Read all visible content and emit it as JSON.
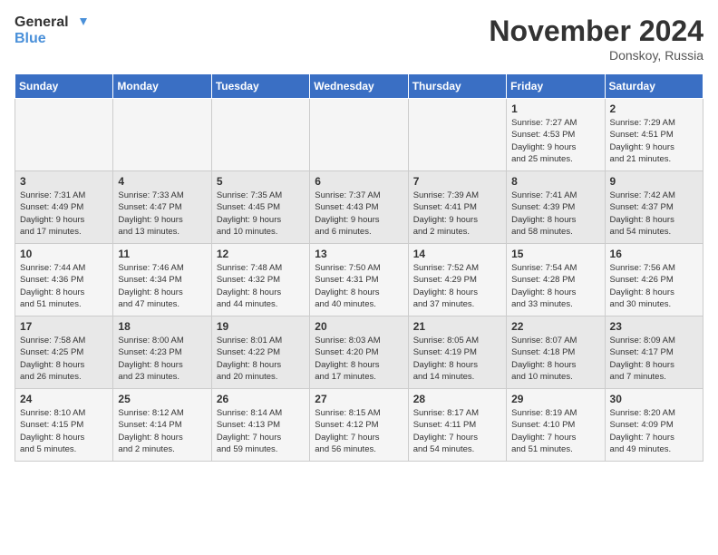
{
  "header": {
    "logo_general": "General",
    "logo_blue": "Blue",
    "month_title": "November 2024",
    "location": "Donskoy, Russia"
  },
  "days_of_week": [
    "Sunday",
    "Monday",
    "Tuesday",
    "Wednesday",
    "Thursday",
    "Friday",
    "Saturday"
  ],
  "weeks": [
    [
      {
        "day": "",
        "info": ""
      },
      {
        "day": "",
        "info": ""
      },
      {
        "day": "",
        "info": ""
      },
      {
        "day": "",
        "info": ""
      },
      {
        "day": "",
        "info": ""
      },
      {
        "day": "1",
        "info": "Sunrise: 7:27 AM\nSunset: 4:53 PM\nDaylight: 9 hours\nand 25 minutes."
      },
      {
        "day": "2",
        "info": "Sunrise: 7:29 AM\nSunset: 4:51 PM\nDaylight: 9 hours\nand 21 minutes."
      }
    ],
    [
      {
        "day": "3",
        "info": "Sunrise: 7:31 AM\nSunset: 4:49 PM\nDaylight: 9 hours\nand 17 minutes."
      },
      {
        "day": "4",
        "info": "Sunrise: 7:33 AM\nSunset: 4:47 PM\nDaylight: 9 hours\nand 13 minutes."
      },
      {
        "day": "5",
        "info": "Sunrise: 7:35 AM\nSunset: 4:45 PM\nDaylight: 9 hours\nand 10 minutes."
      },
      {
        "day": "6",
        "info": "Sunrise: 7:37 AM\nSunset: 4:43 PM\nDaylight: 9 hours\nand 6 minutes."
      },
      {
        "day": "7",
        "info": "Sunrise: 7:39 AM\nSunset: 4:41 PM\nDaylight: 9 hours\nand 2 minutes."
      },
      {
        "day": "8",
        "info": "Sunrise: 7:41 AM\nSunset: 4:39 PM\nDaylight: 8 hours\nand 58 minutes."
      },
      {
        "day": "9",
        "info": "Sunrise: 7:42 AM\nSunset: 4:37 PM\nDaylight: 8 hours\nand 54 minutes."
      }
    ],
    [
      {
        "day": "10",
        "info": "Sunrise: 7:44 AM\nSunset: 4:36 PM\nDaylight: 8 hours\nand 51 minutes."
      },
      {
        "day": "11",
        "info": "Sunrise: 7:46 AM\nSunset: 4:34 PM\nDaylight: 8 hours\nand 47 minutes."
      },
      {
        "day": "12",
        "info": "Sunrise: 7:48 AM\nSunset: 4:32 PM\nDaylight: 8 hours\nand 44 minutes."
      },
      {
        "day": "13",
        "info": "Sunrise: 7:50 AM\nSunset: 4:31 PM\nDaylight: 8 hours\nand 40 minutes."
      },
      {
        "day": "14",
        "info": "Sunrise: 7:52 AM\nSunset: 4:29 PM\nDaylight: 8 hours\nand 37 minutes."
      },
      {
        "day": "15",
        "info": "Sunrise: 7:54 AM\nSunset: 4:28 PM\nDaylight: 8 hours\nand 33 minutes."
      },
      {
        "day": "16",
        "info": "Sunrise: 7:56 AM\nSunset: 4:26 PM\nDaylight: 8 hours\nand 30 minutes."
      }
    ],
    [
      {
        "day": "17",
        "info": "Sunrise: 7:58 AM\nSunset: 4:25 PM\nDaylight: 8 hours\nand 26 minutes."
      },
      {
        "day": "18",
        "info": "Sunrise: 8:00 AM\nSunset: 4:23 PM\nDaylight: 8 hours\nand 23 minutes."
      },
      {
        "day": "19",
        "info": "Sunrise: 8:01 AM\nSunset: 4:22 PM\nDaylight: 8 hours\nand 20 minutes."
      },
      {
        "day": "20",
        "info": "Sunrise: 8:03 AM\nSunset: 4:20 PM\nDaylight: 8 hours\nand 17 minutes."
      },
      {
        "day": "21",
        "info": "Sunrise: 8:05 AM\nSunset: 4:19 PM\nDaylight: 8 hours\nand 14 minutes."
      },
      {
        "day": "22",
        "info": "Sunrise: 8:07 AM\nSunset: 4:18 PM\nDaylight: 8 hours\nand 10 minutes."
      },
      {
        "day": "23",
        "info": "Sunrise: 8:09 AM\nSunset: 4:17 PM\nDaylight: 8 hours\nand 7 minutes."
      }
    ],
    [
      {
        "day": "24",
        "info": "Sunrise: 8:10 AM\nSunset: 4:15 PM\nDaylight: 8 hours\nand 5 minutes."
      },
      {
        "day": "25",
        "info": "Sunrise: 8:12 AM\nSunset: 4:14 PM\nDaylight: 8 hours\nand 2 minutes."
      },
      {
        "day": "26",
        "info": "Sunrise: 8:14 AM\nSunset: 4:13 PM\nDaylight: 7 hours\nand 59 minutes."
      },
      {
        "day": "27",
        "info": "Sunrise: 8:15 AM\nSunset: 4:12 PM\nDaylight: 7 hours\nand 56 minutes."
      },
      {
        "day": "28",
        "info": "Sunrise: 8:17 AM\nSunset: 4:11 PM\nDaylight: 7 hours\nand 54 minutes."
      },
      {
        "day": "29",
        "info": "Sunrise: 8:19 AM\nSunset: 4:10 PM\nDaylight: 7 hours\nand 51 minutes."
      },
      {
        "day": "30",
        "info": "Sunrise: 8:20 AM\nSunset: 4:09 PM\nDaylight: 7 hours\nand 49 minutes."
      }
    ]
  ]
}
